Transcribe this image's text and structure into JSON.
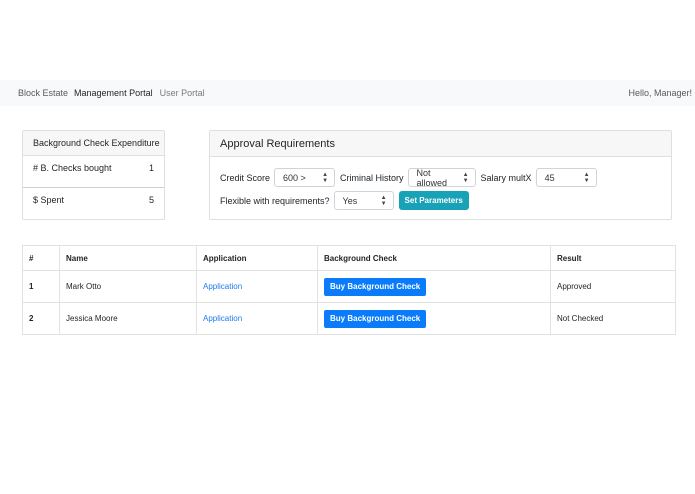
{
  "navbar": {
    "brand": "Block Estate",
    "links": [
      "Management Portal",
      "User Portal"
    ],
    "greeting": "Hello, Manager!"
  },
  "expenditure": {
    "title": "Background Check Expenditure",
    "rows": [
      {
        "label": "# B. Checks bought",
        "value": "1"
      },
      {
        "label": "$ Spent",
        "value": "5"
      }
    ]
  },
  "approval": {
    "title": "Approval Requirements",
    "credit_label": "Credit Score",
    "credit_value": "600 >",
    "criminal_label": "Criminal History",
    "criminal_value": "Not allowed",
    "salary_label": "Salary multX",
    "salary_value": "45",
    "flexible_label": "Flexible with requirements?",
    "flexible_value": "Yes",
    "set_button": "Set Parameters"
  },
  "table": {
    "headers": [
      "#",
      "Name",
      "Application",
      "Background Check",
      "Result"
    ],
    "rows": [
      {
        "num": "1",
        "name": "Mark Otto",
        "application": "Application",
        "check_button": "Buy Background Check",
        "result": "Approved"
      },
      {
        "num": "2",
        "name": "Jessica Moore",
        "application": "Application",
        "check_button": "Buy Background Check",
        "result": "Not Checked"
      }
    ]
  },
  "colors": {
    "accent_blue": "#0a7bfa",
    "accent_teal": "#17a2b8"
  }
}
